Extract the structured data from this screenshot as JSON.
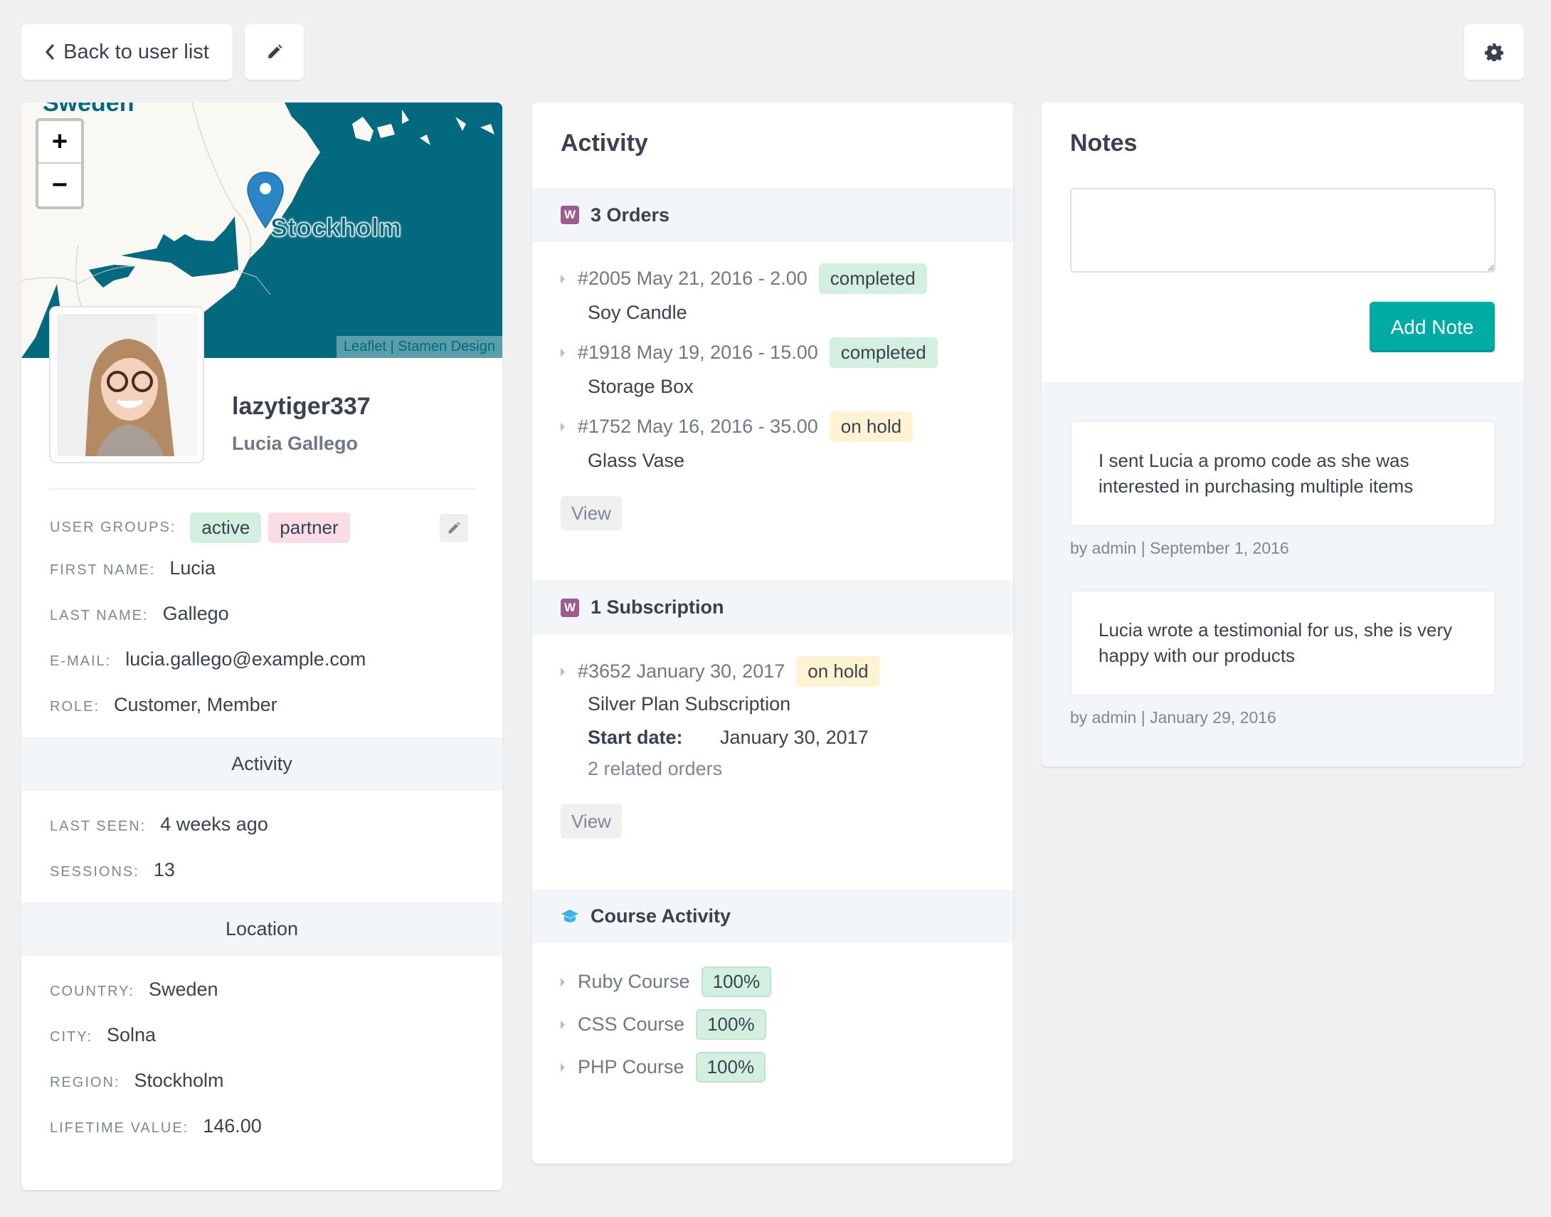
{
  "toolbar": {
    "back_label": "Back to user list",
    "edit_icon": "pencil-icon",
    "settings_icon": "gear-icon"
  },
  "map": {
    "country_label": "Sweden",
    "city_label": "Stockholm",
    "zoom_in": "+",
    "zoom_out": "−",
    "attribution_leaflet": "Leaflet",
    "attribution_sep": "|",
    "attribution_stamen": "Stamen Design",
    "colors": {
      "water": "#02697e",
      "land": "#faf8f2"
    }
  },
  "profile": {
    "username": "lazytiger337",
    "full_name": "Lucia Gallego",
    "user_groups_label": "User groups:",
    "user_groups": [
      {
        "name": "active",
        "color": "#d3efdf"
      },
      {
        "name": "partner",
        "color": "#fadce6"
      }
    ],
    "fields": [
      {
        "label": "First name:",
        "value": "Lucia"
      },
      {
        "label": "Last name:",
        "value": "Gallego"
      },
      {
        "label": "E-mail:",
        "value": "lucia.gallego@example.com"
      },
      {
        "label": "Role:",
        "value": "Customer, Member"
      }
    ]
  },
  "activity_section": {
    "title": "Activity",
    "fields": [
      {
        "label": "Last seen:",
        "value": "4 weeks ago"
      },
      {
        "label": "Sessions:",
        "value": "13"
      }
    ]
  },
  "location_section": {
    "title": "Location",
    "fields": [
      {
        "label": "Country:",
        "value": "Sweden"
      },
      {
        "label": "City:",
        "value": "Solna"
      },
      {
        "label": "Region:",
        "value": "Stockholm"
      },
      {
        "label": "Lifetime value:",
        "value": "146.00"
      }
    ]
  },
  "activity": {
    "title": "Activity",
    "orders": {
      "heading": "3 Orders",
      "icon": "woocommerce-icon",
      "icon_letter": "W",
      "items": [
        {
          "meta": "#2005 May 21, 2016 - 2.00",
          "status": "completed",
          "product": "Soy Candle"
        },
        {
          "meta": "#1918 May 19, 2016 - 15.00",
          "status": "completed",
          "product": "Storage Box"
        },
        {
          "meta": "#1752 May 16, 2016 - 35.00",
          "status": "on hold",
          "product": "Glass Vase"
        }
      ],
      "view_label": "View"
    },
    "subscriptions": {
      "heading": "1 Subscription",
      "icon": "woocommerce-icon",
      "icon_letter": "W",
      "item": {
        "meta": "#3652 January 30, 2017",
        "status": "on hold",
        "plan": "Silver Plan Subscription",
        "start_label": "Start date:",
        "start_value": "January 30, 2017",
        "related": "2 related orders"
      },
      "view_label": "View"
    },
    "courses": {
      "heading": "Course Activity",
      "icon": "graduation-cap-icon",
      "items": [
        {
          "name": "Ruby Course",
          "progress": "100%"
        },
        {
          "name": "CSS Course",
          "progress": "100%"
        },
        {
          "name": "PHP Course",
          "progress": "100%"
        }
      ]
    }
  },
  "notes": {
    "title": "Notes",
    "textarea_value": "",
    "add_label": "Add Note",
    "accent": "#00aaa5",
    "items": [
      {
        "text": "I sent Lucia a promo code as she was interested in purchasing multiple items",
        "meta": "by admin | September 1, 2016"
      },
      {
        "text": "Lucia wrote a testimonial for us, she is very happy with our products",
        "meta": "by admin | January 29, 2016"
      }
    ]
  }
}
